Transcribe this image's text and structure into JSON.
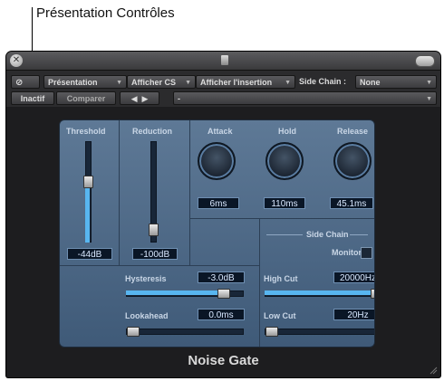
{
  "callout": {
    "label": "Présentation Contrôles"
  },
  "toolbar": {
    "presentation": "Présentation",
    "afficher_cs": "Afficher CS",
    "afficher_insertion": "Afficher l'insertion",
    "side_chain_label": "Side Chain :",
    "side_chain_value": "None",
    "inactif": "Inactif",
    "comparer": "Comparer",
    "preset_value": "-"
  },
  "plugin": {
    "name": "Noise Gate",
    "threshold": {
      "label": "Threshold",
      "value": "-44dB",
      "level": 0.62
    },
    "reduction": {
      "label": "Reduction",
      "value": "-100dB",
      "level": 0.08
    },
    "attack": {
      "label": "Attack",
      "value": "6ms"
    },
    "hold": {
      "label": "Hold",
      "value": "110ms"
    },
    "release": {
      "label": "Release",
      "value": "45.1ms"
    },
    "hysteresis": {
      "label": "Hysteresis",
      "value": "-3.0dB",
      "level": 0.86
    },
    "lookahead": {
      "label": "Lookahead",
      "value": "0.0ms",
      "level": 0.0
    },
    "side_chain": {
      "label": "Side Chain",
      "monitor": "Monitor",
      "high_cut": {
        "label": "High Cut",
        "value": "20000Hz",
        "level": 0.98
      },
      "low_cut": {
        "label": "Low Cut",
        "value": "20Hz",
        "level": 0.0
      }
    }
  },
  "colors": {
    "accent": "#58b6f0",
    "panel": "#4f6a88"
  }
}
